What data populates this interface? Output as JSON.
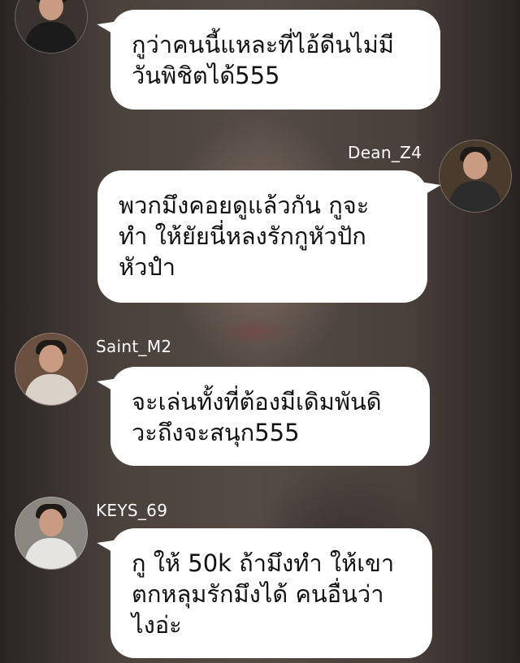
{
  "messages": [
    {
      "sender": "",
      "side": "left",
      "avatar_icon": "user-avatar-photo",
      "text": "กูว่าคนนี้แหละที่ไอ้ดีนไม่มี\nวันพิชิตได้555"
    },
    {
      "sender": "Dean_Z4",
      "side": "right",
      "avatar_icon": "user-avatar-photo",
      "text": "พวกมึงคอยดูแล้วกัน กูจะ\nทำ ให้ยัยนี่หลงรักกูหัวปัก\nหัวปำ"
    },
    {
      "sender": "Saint_M2",
      "side": "left",
      "avatar_icon": "user-avatar-photo",
      "text": "จะเล่นทั้งที่ต้องมีเดิมพันดิ\nวะถึงจะสนุก555"
    },
    {
      "sender": "KEYS_69",
      "side": "left",
      "avatar_icon": "user-avatar-photo",
      "text": "กู ให้ 50k ถ้ามึงทำ ให้เขา\nตกหลุมรักมึงได้ คนอื่นว่า\nไงอ่ะ"
    }
  ],
  "colors": {
    "bubble": "#ffffff",
    "text": "#111111",
    "name": "#ffffff"
  }
}
